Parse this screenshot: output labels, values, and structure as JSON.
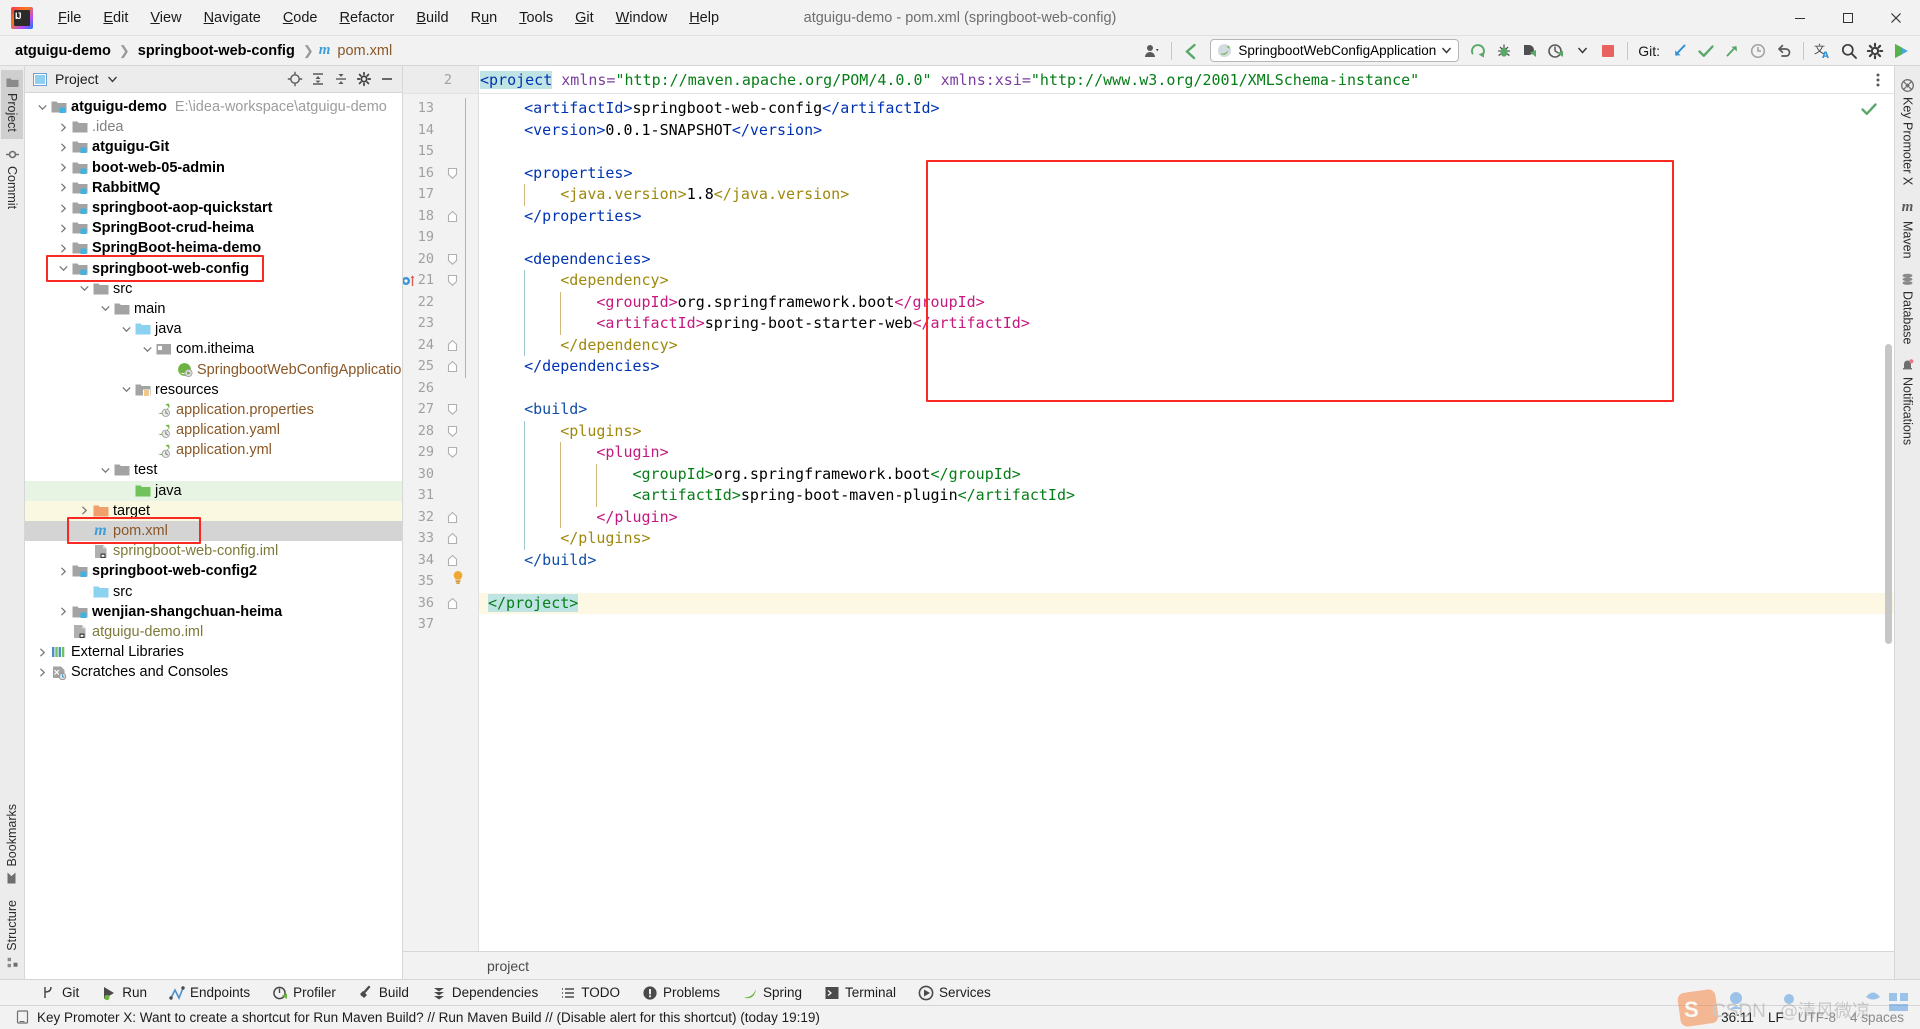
{
  "window": {
    "title": "atguigu-demo - pom.xml (springboot-web-config)",
    "logo_text": "IJ",
    "minimize_label": "minimize-window",
    "maximize_label": "maximize-window",
    "close_label": "close-window"
  },
  "menu": [
    {
      "label": "File"
    },
    {
      "label": "Edit"
    },
    {
      "label": "View"
    },
    {
      "label": "Navigate"
    },
    {
      "label": "Code"
    },
    {
      "label": "Refactor"
    },
    {
      "label": "Build"
    },
    {
      "label": "Run"
    },
    {
      "label": "Tools"
    },
    {
      "label": "Git"
    },
    {
      "label": "Window"
    },
    {
      "label": "Help"
    }
  ],
  "breadcrumbs": [
    {
      "label": "atguigu-demo",
      "style": "bold"
    },
    {
      "label": "springboot-web-config",
      "style": "bold"
    },
    {
      "label": "pom.xml",
      "style": "file",
      "icon": "maven-m-icon"
    }
  ],
  "toolbar": {
    "run_config": "SpringbootWebConfigApplication",
    "run_config_icon": "spring-boot-leaf-icon",
    "git_label": "Git:",
    "buttons": [
      {
        "name": "settings-sync-icon",
        "label": ""
      },
      {
        "name": "run-icon",
        "label": ""
      },
      {
        "name": "debug-icon",
        "label": ""
      },
      {
        "name": "run-with-coverage-icon",
        "label": ""
      },
      {
        "name": "profiler-icon",
        "label": ""
      },
      {
        "name": "stop-icon",
        "label": ""
      },
      {
        "name": "git-update-project-icon",
        "label": ""
      },
      {
        "name": "git-commit-icon",
        "label": ""
      },
      {
        "name": "git-push-icon",
        "label": ""
      },
      {
        "name": "git-history-icon",
        "label": ""
      },
      {
        "name": "git-rollback-icon",
        "label": ""
      },
      {
        "name": "translate-icon",
        "label": ""
      },
      {
        "name": "search-everywhere-icon",
        "label": ""
      },
      {
        "name": "settings-gear-icon",
        "label": ""
      },
      {
        "name": "run-anything-icon",
        "label": ""
      }
    ]
  },
  "left_stripe": {
    "top": [
      {
        "label": "Project",
        "icon": "project-folder-icon",
        "active": true
      },
      {
        "label": "Commit",
        "icon": "commit-node-icon",
        "active": false
      }
    ],
    "bottom": [
      {
        "label": "Bookmarks",
        "icon": "bookmark-icon",
        "active": false
      },
      {
        "label": "Structure",
        "icon": "structure-icon",
        "active": false
      }
    ]
  },
  "right_stripe": [
    {
      "label": "Key Promoter X",
      "icon": "key-promoter-icon"
    },
    {
      "label": "Maven",
      "icon": "maven-m-icon"
    },
    {
      "label": "Database",
      "icon": "database-icon"
    },
    {
      "label": "Notifications",
      "icon": "notifications-bell-icon"
    }
  ],
  "project_panel": {
    "title": "Project",
    "actions": [
      {
        "name": "select-opened-file-icon"
      },
      {
        "name": "expand-all-icon"
      },
      {
        "name": "collapse-all-icon"
      },
      {
        "name": "panel-settings-gear-icon"
      },
      {
        "name": "hide-panel-icon"
      }
    ],
    "tree": [
      {
        "label": "atguigu-demo",
        "sub": "E:\\idea-workspace\\atguigu-demo",
        "depth": 0,
        "arrow": "down",
        "icon": "module-folder-icon",
        "bold": true,
        "color": "black"
      },
      {
        "label": ".idea",
        "depth": 1,
        "arrow": "right",
        "icon": "folder-grey-icon",
        "bold": false,
        "color": "grey"
      },
      {
        "label": "atguigu-Git",
        "depth": 1,
        "arrow": "right",
        "icon": "module-folder-icon",
        "bold": true,
        "color": "black"
      },
      {
        "label": "boot-web-05-admin",
        "depth": 1,
        "arrow": "right",
        "icon": "module-folder-icon",
        "bold": true,
        "color": "black"
      },
      {
        "label": "RabbitMQ",
        "depth": 1,
        "arrow": "right",
        "icon": "module-folder-icon",
        "bold": true,
        "color": "black"
      },
      {
        "label": "springboot-aop-quickstart",
        "depth": 1,
        "arrow": "right",
        "icon": "module-folder-icon",
        "bold": true,
        "color": "black"
      },
      {
        "label": "SpringBoot-crud-heima",
        "depth": 1,
        "arrow": "right",
        "icon": "module-folder-icon",
        "bold": true,
        "color": "black"
      },
      {
        "label": "SpringBoot-heima-demo",
        "depth": 1,
        "arrow": "right",
        "icon": "module-folder-icon",
        "bold": true,
        "color": "black"
      },
      {
        "label": "springboot-web-config",
        "depth": 1,
        "arrow": "down",
        "icon": "module-folder-icon",
        "bold": true,
        "color": "black",
        "boxed": true
      },
      {
        "label": "src",
        "depth": 2,
        "arrow": "down",
        "icon": "folder-grey-icon",
        "bold": false,
        "color": "black"
      },
      {
        "label": "main",
        "depth": 3,
        "arrow": "down",
        "icon": "folder-grey-icon",
        "bold": false,
        "color": "black"
      },
      {
        "label": "java",
        "depth": 4,
        "arrow": "down",
        "icon": "source-root-blue-icon",
        "bold": false,
        "color": "black"
      },
      {
        "label": "com.itheima",
        "depth": 5,
        "arrow": "down",
        "icon": "package-icon",
        "bold": false,
        "color": "black"
      },
      {
        "label": "SpringbootWebConfigApplication",
        "depth": 6,
        "arrow": "none",
        "icon": "spring-boot-class-icon",
        "bold": false,
        "color": "orange"
      },
      {
        "label": "resources",
        "depth": 4,
        "arrow": "down",
        "icon": "resources-root-icon",
        "bold": false,
        "color": "black"
      },
      {
        "label": "application.properties",
        "depth": 5,
        "arrow": "none",
        "icon": "spring-leaf-file-icon",
        "bold": false,
        "color": "orange"
      },
      {
        "label": "application.yaml",
        "depth": 5,
        "arrow": "none",
        "icon": "spring-leaf-file-icon",
        "bold": false,
        "color": "orange"
      },
      {
        "label": "application.yml",
        "depth": 5,
        "arrow": "none",
        "icon": "spring-leaf-file-icon",
        "bold": false,
        "color": "orange"
      },
      {
        "label": "test",
        "depth": 3,
        "arrow": "down",
        "icon": "folder-grey-icon",
        "bold": false,
        "color": "black"
      },
      {
        "label": "java",
        "depth": 4,
        "arrow": "none",
        "icon": "test-source-root-green-icon",
        "bold": false,
        "color": "black",
        "highlight": "green"
      },
      {
        "label": "target",
        "depth": 2,
        "arrow": "right",
        "icon": "excluded-folder-orange-icon",
        "bold": false,
        "color": "black",
        "highlight": "yellow"
      },
      {
        "label": "pom.xml",
        "depth": 2,
        "arrow": "none",
        "icon": "maven-m-icon",
        "bold": false,
        "color": "orange",
        "selected": true,
        "boxed": true
      },
      {
        "label": "springboot-web-config.iml",
        "depth": 2,
        "arrow": "none",
        "icon": "iml-file-icon",
        "bold": false,
        "color": "olive"
      },
      {
        "label": "springboot-web-config2",
        "depth": 1,
        "arrow": "right",
        "icon": "module-folder-icon",
        "bold": true,
        "color": "black"
      },
      {
        "label": "src",
        "depth": 2,
        "arrow": "none",
        "icon": "source-root-blue-icon",
        "bold": false,
        "color": "black"
      },
      {
        "label": "wenjian-shangchuan-heima",
        "depth": 1,
        "arrow": "right",
        "icon": "module-folder-icon",
        "bold": true,
        "color": "black"
      },
      {
        "label": "atguigu-demo.iml",
        "depth": 1,
        "arrow": "none",
        "icon": "iml-file-icon",
        "bold": false,
        "color": "olive"
      },
      {
        "label": "External Libraries",
        "depth": 0,
        "arrow": "right",
        "icon": "external-libraries-icon",
        "bold": false,
        "color": "black"
      },
      {
        "label": "Scratches and Consoles",
        "depth": 0,
        "arrow": "right",
        "icon": "scratches-icon",
        "bold": false,
        "color": "black"
      }
    ]
  },
  "editor": {
    "sticky_line_number": "2",
    "sticky_line_segments": [
      {
        "t": "<project",
        "c": "tag"
      },
      {
        "t": " xmlns=",
        "c": "attr"
      },
      {
        "t": "\"http://maven.apache.org/POM/4.0.0\"",
        "c": "str"
      },
      {
        "t": " xmlns:xsi=",
        "c": "attr"
      },
      {
        "t": "\"http://www.w3.org/2001/XMLSchema-instance\"",
        "c": "str"
      }
    ],
    "breadcrumb_footer": "project",
    "inspection_status_icon": "inspection-ok-check-icon",
    "lines": [
      {
        "n": "13",
        "fold": "none",
        "segs": [
          {
            "t": "    ",
            "c": "txt"
          },
          {
            "t": "<artifactId>",
            "c": "tag"
          },
          {
            "t": "springboot-web-config",
            "c": "txt"
          },
          {
            "t": "</artifactId>",
            "c": "tag"
          }
        ]
      },
      {
        "n": "14",
        "fold": "none",
        "segs": [
          {
            "t": "    ",
            "c": "txt"
          },
          {
            "t": "<version>",
            "c": "tag"
          },
          {
            "t": "0.0.1-SNAPSHOT",
            "c": "txt"
          },
          {
            "t": "</version>",
            "c": "tag"
          }
        ]
      },
      {
        "n": "15",
        "fold": "none",
        "segs": []
      },
      {
        "n": "16",
        "fold": "open",
        "segs": [
          {
            "t": "    ",
            "c": "txt"
          },
          {
            "t": "<properties>",
            "c": "tag"
          }
        ]
      },
      {
        "n": "17",
        "fold": "none",
        "segs": [
          {
            "t": "        ",
            "c": "txt"
          },
          {
            "t": "<java.version>",
            "c": "olive"
          },
          {
            "t": "1.8",
            "c": "txt"
          },
          {
            "t": "</java.version>",
            "c": "olive"
          }
        ]
      },
      {
        "n": "18",
        "fold": "close",
        "segs": [
          {
            "t": "    ",
            "c": "txt"
          },
          {
            "t": "</properties>",
            "c": "tag"
          }
        ]
      },
      {
        "n": "19",
        "fold": "none",
        "segs": []
      },
      {
        "n": "20",
        "fold": "open",
        "segs": [
          {
            "t": "    ",
            "c": "txt"
          },
          {
            "t": "<dependencies>",
            "c": "tag"
          }
        ]
      },
      {
        "n": "21",
        "fold": "open",
        "marker": "breakpoint-bean-icon",
        "segs": [
          {
            "t": "        ",
            "c": "txt"
          },
          {
            "t": "<dependency>",
            "c": "olive"
          }
        ]
      },
      {
        "n": "22",
        "fold": "none",
        "segs": [
          {
            "t": "            ",
            "c": "txt"
          },
          {
            "t": "<groupId>",
            "c": "magenta"
          },
          {
            "t": "org.springframework.boot",
            "c": "txt"
          },
          {
            "t": "</groupId>",
            "c": "magenta"
          }
        ]
      },
      {
        "n": "23",
        "fold": "none",
        "segs": [
          {
            "t": "            ",
            "c": "txt"
          },
          {
            "t": "<artifactId>",
            "c": "magenta"
          },
          {
            "t": "spring-boot-starter-web",
            "c": "txt"
          },
          {
            "t": "</artifactId>",
            "c": "magenta"
          }
        ]
      },
      {
        "n": "24",
        "fold": "close",
        "segs": [
          {
            "t": "        ",
            "c": "txt"
          },
          {
            "t": "</dependency>",
            "c": "olive"
          }
        ]
      },
      {
        "n": "25",
        "fold": "close",
        "segs": [
          {
            "t": "    ",
            "c": "txt"
          },
          {
            "t": "</dependencies>",
            "c": "tag"
          }
        ]
      },
      {
        "n": "26",
        "fold": "none",
        "segs": []
      },
      {
        "n": "27",
        "fold": "open",
        "segs": [
          {
            "t": "    ",
            "c": "txt"
          },
          {
            "t": "<build>",
            "c": "dblue"
          }
        ]
      },
      {
        "n": "28",
        "fold": "open",
        "segs": [
          {
            "t": "        ",
            "c": "txt"
          },
          {
            "t": "<plugins>",
            "c": "olive"
          }
        ]
      },
      {
        "n": "29",
        "fold": "open",
        "segs": [
          {
            "t": "            ",
            "c": "txt"
          },
          {
            "t": "<plugin>",
            "c": "magenta"
          }
        ]
      },
      {
        "n": "30",
        "fold": "none",
        "segs": [
          {
            "t": "                ",
            "c": "txt"
          },
          {
            "t": "<groupId>",
            "c": "green"
          },
          {
            "t": "org.springframework.boot",
            "c": "txt"
          },
          {
            "t": "</groupId>",
            "c": "green"
          }
        ]
      },
      {
        "n": "31",
        "fold": "none",
        "segs": [
          {
            "t": "                ",
            "c": "txt"
          },
          {
            "t": "<artifactId>",
            "c": "green"
          },
          {
            "t": "spring-boot-maven-plugin",
            "c": "txt"
          },
          {
            "t": "</artifactId>",
            "c": "green"
          }
        ]
      },
      {
        "n": "32",
        "fold": "close",
        "segs": [
          {
            "t": "            ",
            "c": "txt"
          },
          {
            "t": "</plugin>",
            "c": "magenta"
          }
        ]
      },
      {
        "n": "33",
        "fold": "close",
        "segs": [
          {
            "t": "        ",
            "c": "txt"
          },
          {
            "t": "</plugins>",
            "c": "olive"
          }
        ]
      },
      {
        "n": "34",
        "fold": "close",
        "segs": [
          {
            "t": "    ",
            "c": "txt"
          },
          {
            "t": "</build>",
            "c": "dblue"
          }
        ]
      },
      {
        "n": "35",
        "fold": "none",
        "marker": "intention-bulb-icon",
        "segs": []
      },
      {
        "n": "36",
        "fold": "close",
        "rowhl": true,
        "segs": [
          {
            "t": "</project>",
            "c": "green",
            "match": true
          }
        ]
      },
      {
        "n": "37",
        "fold": "none",
        "segs": []
      }
    ]
  },
  "bottom_tool_window": [
    {
      "label": "Git",
      "icon": "git-branch-icon"
    },
    {
      "label": "Run",
      "icon": "run-play-icon"
    },
    {
      "label": "Endpoints",
      "icon": "endpoints-icon"
    },
    {
      "label": "Profiler",
      "icon": "profiler-icon"
    },
    {
      "label": "Build",
      "icon": "build-hammer-icon"
    },
    {
      "label": "Dependencies",
      "icon": "dependencies-icon"
    },
    {
      "label": "TODO",
      "icon": "todo-list-icon"
    },
    {
      "label": "Problems",
      "icon": "problems-warning-icon"
    },
    {
      "label": "Spring",
      "icon": "spring-leaf-icon"
    },
    {
      "label": "Terminal",
      "icon": "terminal-icon"
    },
    {
      "label": "Services",
      "icon": "services-icon"
    }
  ],
  "statusbar": {
    "message": "Key Promoter X: Want to create a shortcut for Run Maven Build? // Run Maven Build // (Disable alert for this shortcut) (today 19:19)",
    "message_icon": "notification-balloon-icon",
    "caret_position": "36:11",
    "line_separator": "LF",
    "encoding": "UTF-8",
    "indent": "4 spaces",
    "watermark_text": "CSDN @清风微凉"
  },
  "colors": {
    "accent_red_box": "#fa2a22",
    "selection_grey": "#d4d4d4",
    "row_highlight_yellow": "#fdf8e3",
    "match_cyan": "#c0e4e4",
    "tag_blue": "#0033b3",
    "string_green": "#067d17",
    "magenta": "#c5197e",
    "olive": "#9e880d"
  }
}
